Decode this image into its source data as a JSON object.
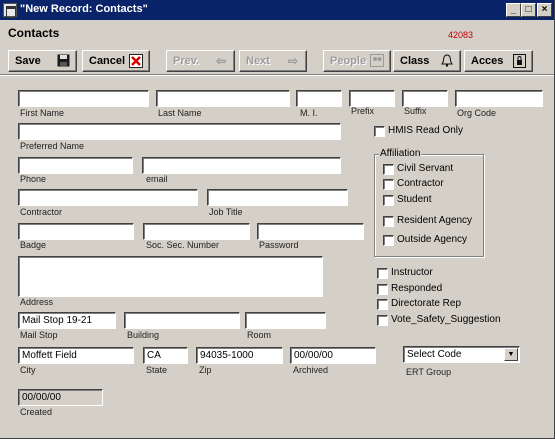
{
  "window": {
    "title": "\"New Record: Contacts\"",
    "minimize": "_",
    "maximize": "□",
    "close": "×"
  },
  "header": {
    "title": "Contacts",
    "record_id": "42083"
  },
  "toolbar": {
    "save": "Save",
    "cancel": "Cancel",
    "prev": "Prev.",
    "next": "Next",
    "people": "People",
    "class": "Class",
    "access": "Acces"
  },
  "fields": {
    "first_name": {
      "label": "First Name",
      "value": ""
    },
    "last_name": {
      "label": "Last Name",
      "value": ""
    },
    "mi": {
      "label": "M. I.",
      "value": ""
    },
    "prefix": {
      "label": "Prefix",
      "value": ""
    },
    "suffix": {
      "label": "Suffix",
      "value": ""
    },
    "org_code": {
      "label": "Org Code",
      "value": ""
    },
    "preferred_name": {
      "label": "Preferred Name",
      "value": ""
    },
    "phone": {
      "label": "Phone",
      "value": ""
    },
    "email": {
      "label": "email",
      "value": ""
    },
    "contractor": {
      "label": "Contractor",
      "value": ""
    },
    "job_title": {
      "label": "Job Title",
      "value": ""
    },
    "badge": {
      "label": "Badge",
      "value": ""
    },
    "ssn": {
      "label": "Soc. Sec. Number",
      "value": ""
    },
    "password": {
      "label": "Password",
      "value": ""
    },
    "address": {
      "label": "Address",
      "value": ""
    },
    "mail_stop": {
      "label": "Mail Stop",
      "value": "Mail Stop 19-21"
    },
    "building": {
      "label": "Building",
      "value": ""
    },
    "room": {
      "label": "Room",
      "value": ""
    },
    "city": {
      "label": "City",
      "value": "Moffett Field"
    },
    "state": {
      "label": "State",
      "value": "CA"
    },
    "zip": {
      "label": "Zip",
      "value": "94035-1000"
    },
    "archived": {
      "label": "Archived",
      "value": "00/00/00"
    },
    "created": {
      "label": "Created",
      "value": "00/00/00"
    }
  },
  "hmis_read_only": "HMIS Read Only",
  "affiliation": {
    "title": "Affiliation",
    "items": [
      "Civil Servant",
      "Contractor",
      "Student",
      "Resident Agency",
      "Outside Agency"
    ]
  },
  "roles": [
    "Instructor",
    "Responded",
    "Directorate Rep",
    "Vote_Safety_Suggestion"
  ],
  "ert_group": {
    "label": "ERT Group",
    "selected": "Select Code"
  },
  "icons": {
    "save": "floppy-icon",
    "cancel": "cancel-icon",
    "prev": "left-arrow-icon",
    "next": "right-arrow-icon",
    "people": "people-icon",
    "class": "bell-icon",
    "access": "lock-icon"
  }
}
